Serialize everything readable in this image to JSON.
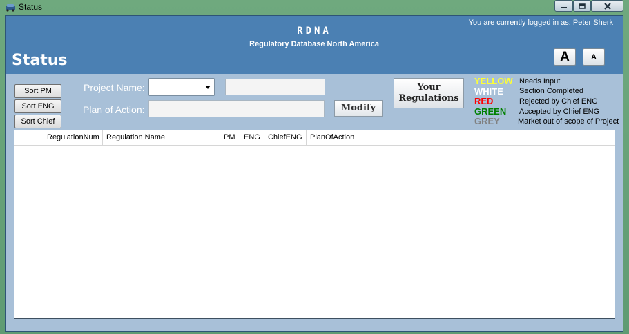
{
  "window": {
    "title": "Status",
    "controls": {
      "minimize_icon": "minimize-icon",
      "maximize_icon": "maximize-icon",
      "close_icon": "close-icon"
    }
  },
  "header": {
    "logged_in": "You are currently logged in as: Peter Sherk",
    "app_name": "RDNA",
    "app_subtitle": "Regulatory Database North America",
    "page_title": "Status",
    "font_large_label": "A",
    "font_small_label": "A"
  },
  "toolbar": {
    "sort_pm": "Sort PM",
    "sort_eng": "Sort ENG",
    "sort_chief": "Sort Chief",
    "project_name_label": "Project Name:",
    "project_name_value": "",
    "project_text_value": "",
    "plan_of_action_label": "Plan of Action:",
    "plan_of_action_value": "",
    "modify_label": "Modify",
    "your_regulations_line1": "Your",
    "your_regulations_line2": "Regulations"
  },
  "legend": [
    {
      "color_name": "YELLOW",
      "color": "#ffff33",
      "description": "Needs Input"
    },
    {
      "color_name": "WHITE",
      "color": "#ffffff",
      "description": "Section Completed"
    },
    {
      "color_name": "RED",
      "color": "#ff0000",
      "description": "Rejected by Chief ENG"
    },
    {
      "color_name": "GREEN",
      "color": "#008000",
      "description": "Accepted by Chief ENG"
    },
    {
      "color_name": "GREY",
      "color": "#808080",
      "description": "Market out of scope of Project"
    }
  ],
  "grid": {
    "columns": [
      "RegulationNum",
      "Regulation Name",
      "PM",
      "ENG",
      "ChiefENG",
      "PlanOfAction"
    ],
    "rows": []
  }
}
